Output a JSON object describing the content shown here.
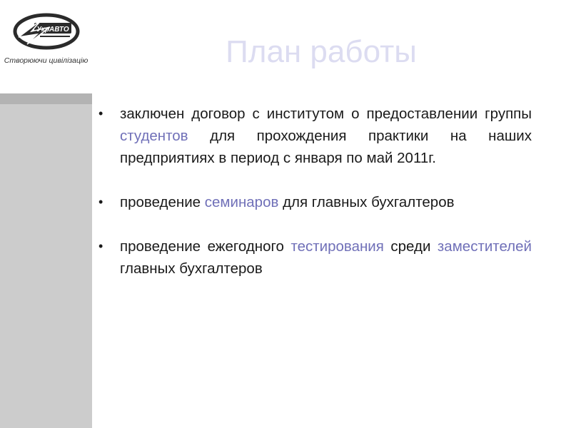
{
  "sidebar": {
    "logo_text": "УкрАВТО",
    "tagline": "Створюючи цивілізацію"
  },
  "slide": {
    "title": "План работы",
    "bullets": [
      {
        "marker": "•",
        "text_1": "заключен договор с институтом о предоставлении группы ",
        "highlight_1": "студентов",
        "text_2": " для прохождения практики на наших предприятиях в период с января по май 2011г."
      },
      {
        "marker": "•",
        "text_1": "проведение ",
        "highlight_1": "семинаров",
        "text_2": " для главных бухгалтеров"
      },
      {
        "marker": "•",
        "text_1": "проведение ежегодного ",
        "highlight_1": "тестирования",
        "text_2": " среди ",
        "highlight_2": "заместителей",
        "text_3": " главных бухгалтеров"
      }
    ]
  },
  "colors": {
    "title": "#dcdcf1",
    "highlight": "#7070b8",
    "sidebar": "#cccccc"
  }
}
